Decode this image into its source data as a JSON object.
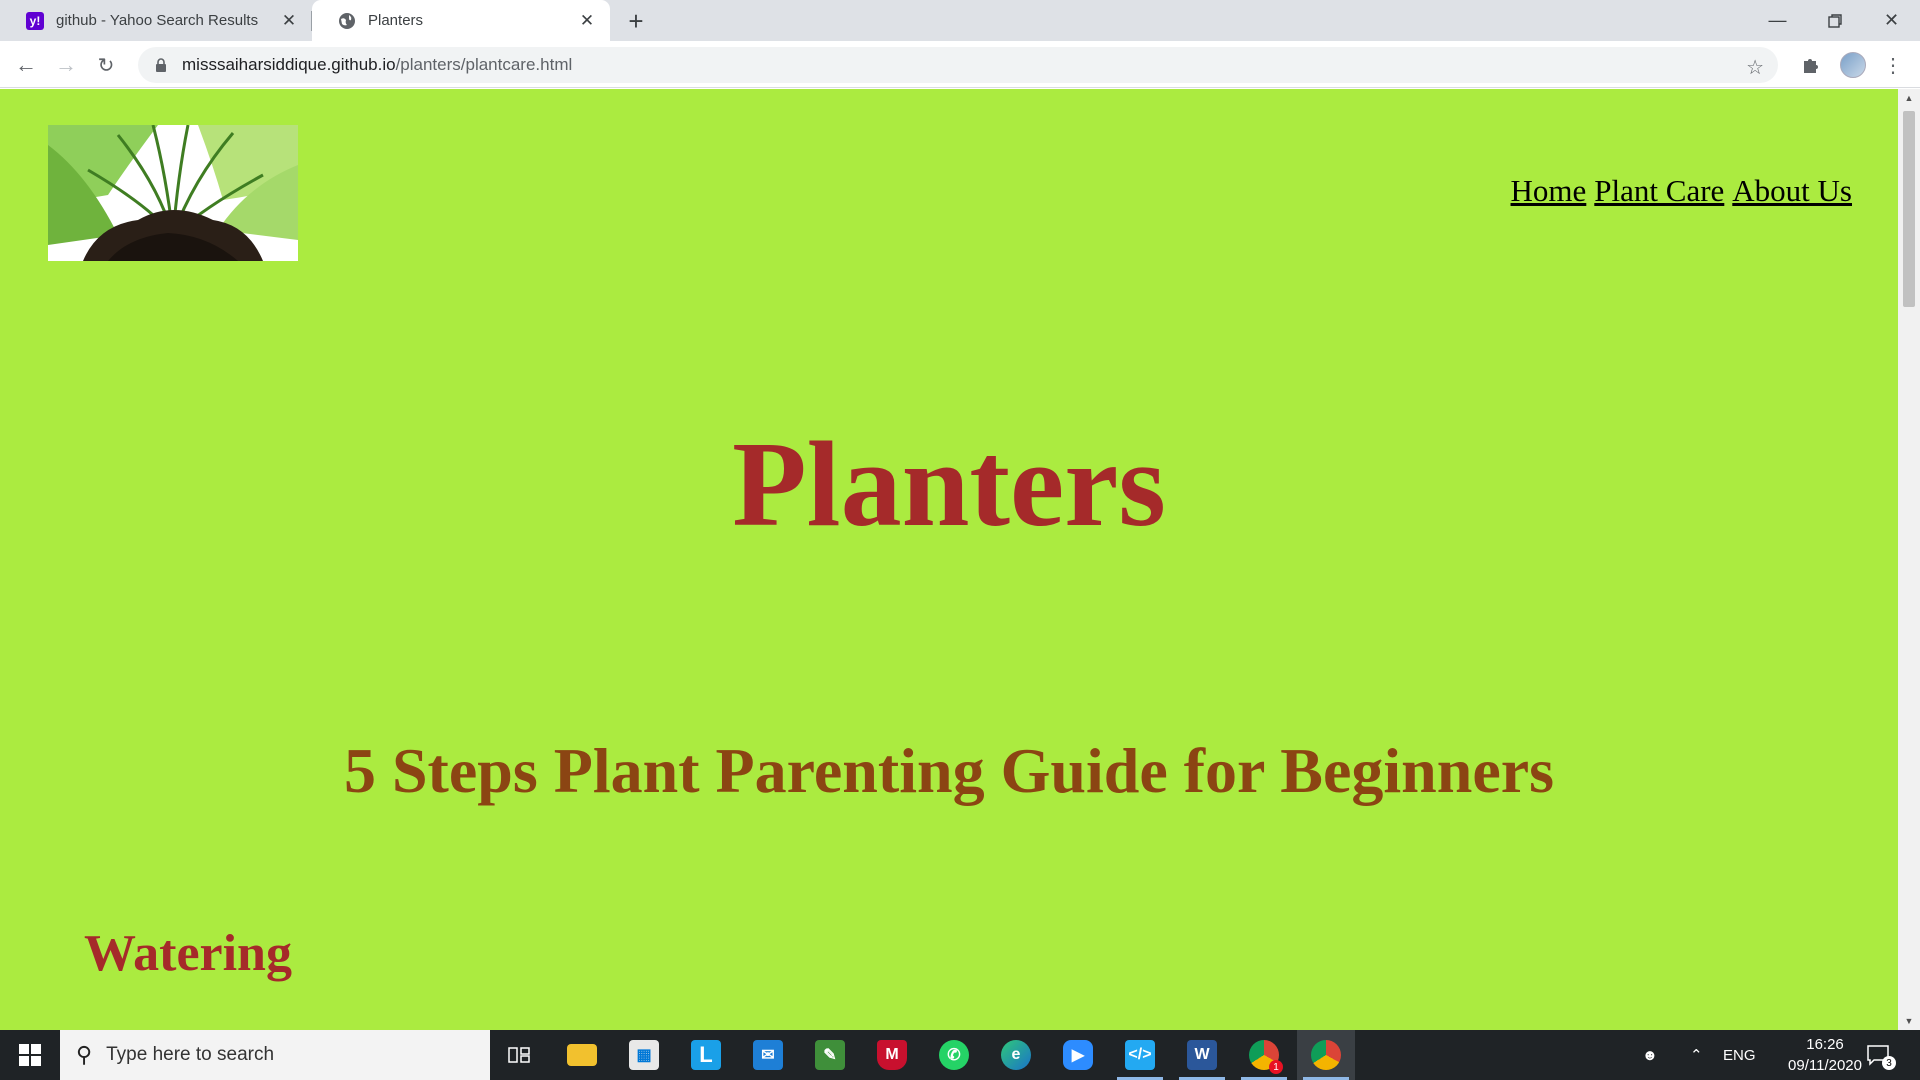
{
  "browser": {
    "tabs": [
      {
        "title": "github - Yahoo Search Results",
        "icon": "yahoo-favicon",
        "active": false
      },
      {
        "title": "Planters",
        "icon": "globe-icon",
        "active": true
      }
    ],
    "url_host": "misssaiharsiddique.github.io",
    "url_path": "/planters/plantcare.html"
  },
  "page": {
    "nav": [
      "Home",
      "Plant Care",
      "About Us"
    ],
    "site_title": "Planters",
    "guide_title": "5 Steps Plant Parenting Guide for Beginners",
    "section_heading": "Watering",
    "colors": {
      "background": "#abeb40",
      "title": "#a52a2a",
      "subtitle": "#8b4513"
    }
  },
  "taskbar": {
    "search_placeholder": "Type here to search",
    "language": "ENG",
    "time": "16:26",
    "date": "09/11/2020",
    "notification_count": "3",
    "badge_count": "1"
  }
}
